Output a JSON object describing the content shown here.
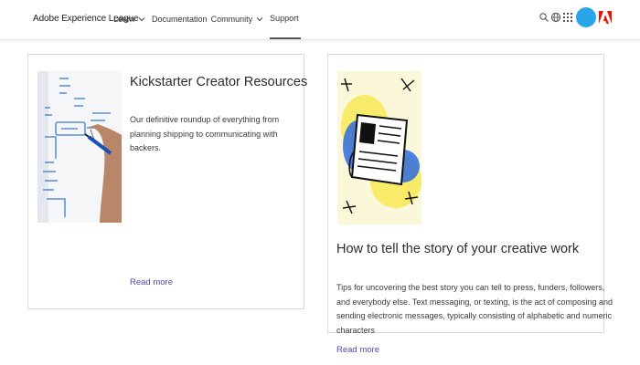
{
  "header": {
    "brand": "Adobe Experience League",
    "nav": {
      "learn": "Learn",
      "documentation": "Documentation",
      "community": "Community",
      "support": "Support"
    },
    "icons": [
      "search-icon",
      "globe-icon",
      "apps-grid-icon",
      "avatar",
      "adobe-logo-icon"
    ],
    "colors": {
      "avatar": "#2aa5e8",
      "adobe_red": "#eb1000",
      "link": "#4a4ab0"
    }
  },
  "cards": [
    {
      "title": "Kickstarter Creator Resources",
      "description": "Our definitive roundup of everything from planning shipping to communicating with backers.",
      "read_more": "Read more",
      "image": "whiteboard-sketch-photo"
    },
    {
      "title": "How to tell the story of your creative work",
      "description": "Tips for uncovering the best story you can tell to press, funders, followers, and everybody else. Text messaging, or texting, is the act of composing and sending electronic messages, typically consisting of alphabetic and numeric characters",
      "read_more": "Read more",
      "image": "newspaper-illustration"
    }
  ]
}
